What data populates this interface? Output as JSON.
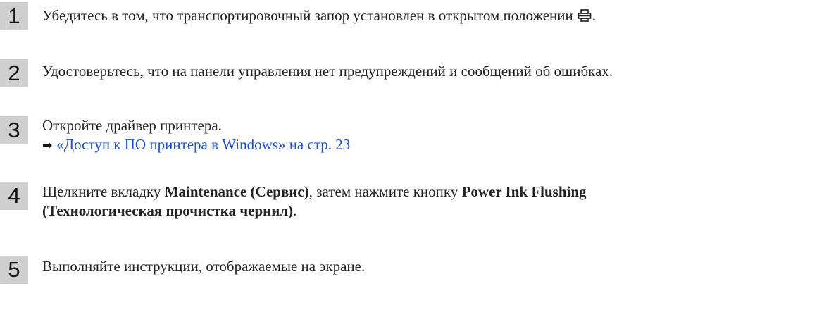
{
  "steps": [
    {
      "number": "1",
      "text_before_icon": "Убедитесь в том, что транспортировочный запор установлен в открытом положении",
      "icon": "printer-unlock-icon",
      "text_after_icon": "."
    },
    {
      "number": "2",
      "text": "Удостоверьтесь, что на панели управления нет предупреждений и сообщений об ошибках."
    },
    {
      "number": "3",
      "text": "Откройте драйвер принтера.",
      "link_arrow": "➡",
      "link_text": "«Доступ к ПО принтера в Windows» на стр. 23"
    },
    {
      "number": "4",
      "text_1": "Щелкните вкладку ",
      "bold_1": "Maintenance (Сервис)",
      "text_2": ", затем нажмите кнопку ",
      "bold_2a": "Power Ink Flushing",
      "bold_2b": "(Технологическая прочистка чернил)",
      "text_3": "."
    },
    {
      "number": "5",
      "text": "Выполняйте инструкции, отображаемые на экране."
    }
  ],
  "colors": {
    "badge_bg": "#cfcfcf",
    "text": "#222222",
    "link": "#1a4fd6"
  }
}
